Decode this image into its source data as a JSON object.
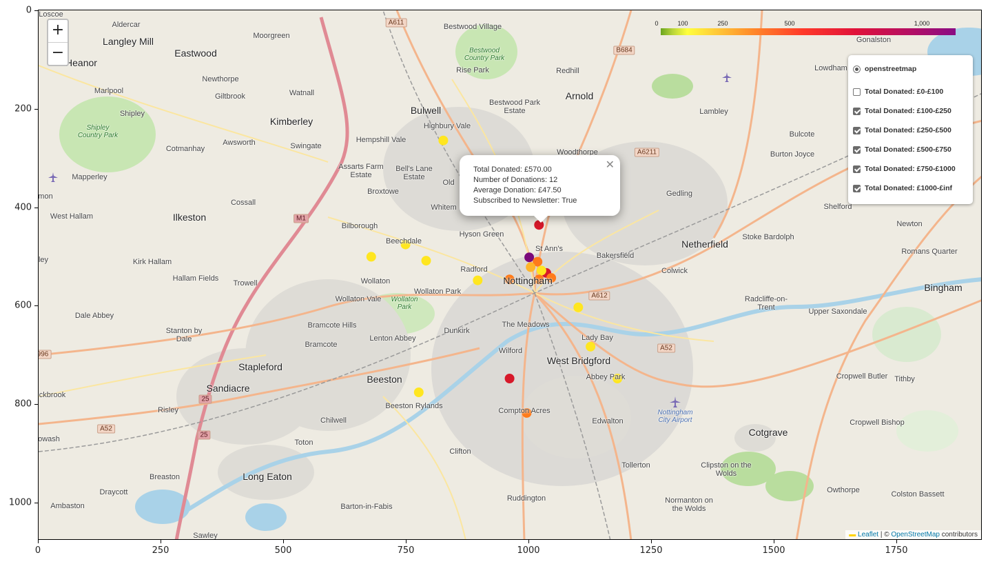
{
  "axes": {
    "x_ticks": [
      "0",
      "250",
      "500",
      "750",
      "1000",
      "1250",
      "1500",
      "1750"
    ],
    "y_ticks": [
      "0",
      "200",
      "400",
      "600",
      "800",
      "1000"
    ]
  },
  "zoom": {
    "in_label": "+",
    "out_label": "−"
  },
  "colorbar": {
    "labels": [
      "0",
      "100",
      "250",
      "500",
      "1,000"
    ],
    "colors": [
      "#6aa51f",
      "#ffff3c",
      "#ff8a2a",
      "#ff3a2a",
      "#e0123a",
      "#8a0c84"
    ]
  },
  "popup": {
    "close_label": "✕",
    "line1": "Total Donated: £570.00",
    "line2": "Number of Donations: 12",
    "line3": "Average Donation: £47.50",
    "line4": "Subscribed to Newsletter: True"
  },
  "layer_control": {
    "base_layer": "openstreetmap",
    "overlays": [
      {
        "label": "Total Donated: £0-£100",
        "checked": false
      },
      {
        "label": "Total Donated: £100-£250",
        "checked": true
      },
      {
        "label": "Total Donated: £250-£500",
        "checked": true
      },
      {
        "label": "Total Donated: £500-£750",
        "checked": true
      },
      {
        "label": "Total Donated: £750-£1000",
        "checked": true
      },
      {
        "label": "Total Donated: £1000-£inf",
        "checked": true
      }
    ]
  },
  "attribution": {
    "leaflet": "Leaflet",
    "sep": " | © ",
    "osm": "OpenStreetMap",
    "tail": " contributors",
    "flag": "▬"
  },
  "places": [
    "Loscoe",
    "Aldercar",
    "Langley Mill",
    "Eastwood",
    "Moorgreen",
    "Bestwood Village",
    "Heanor",
    "Newthorpe",
    "Giltbrook",
    "Watnall",
    "Marlpool",
    "Shipley",
    "Kimberley",
    "Bulwell",
    "Bestwood Park Estate",
    "Arnold",
    "Redhill",
    "Rise Park",
    "Hempshill Vale",
    "Highbury Vale",
    "Swingate",
    "Awsworth",
    "Cotmanhay",
    "Woodthorpe",
    "Assarts Farm Estate",
    "Bell's Lane Estate",
    "Broxtowe",
    "Mapperley",
    "Cossall",
    "Ilkeston",
    "West Hallam",
    "Gedling",
    "Lambley",
    "Burton Joyce",
    "Bulcote",
    "Shelford",
    "Newton",
    "Stoke Bardolph",
    "Netherfield",
    "Colwick",
    "Bakersfield",
    "St Ann's",
    "Hyson Green",
    "Bilborough",
    "Beechdale",
    "Kirk Hallam",
    "Hallam Fields",
    "Trowell",
    "Wollaton",
    "Wollaton Park",
    "Wollaton Vale",
    "Radford",
    "Nottingham",
    "Dale Abbey",
    "Bramcote Hills",
    "Bramcote",
    "Lenton Abbey",
    "Dunkirk",
    "The Meadows",
    "Lady Bay",
    "Wilford",
    "West Bridgford",
    "Abbey Park",
    "Stanton by Dale",
    "Stapleford",
    "Sandiacre",
    "Beeston",
    "Beeston Rylands",
    "Risley",
    "Chilwell",
    "Compton Acres",
    "Edwalton",
    "Toton",
    "Clifton",
    "Tollerton",
    "Long Eaton",
    "Breaston",
    "Draycott",
    "Ambaston",
    "Barton-in-Fabis",
    "Ruddington",
    "Sawley",
    "Normanton on the Wolds",
    "Clipston on the Wolds",
    "Cotgrave",
    "Owthorpe",
    "Colston Bassett",
    "Cropwell Bishop",
    "Cropwell Butler",
    "Tithby",
    "Radcliffe-on-Trent",
    "Upper Saxondale",
    "Bingham",
    "Romans Quarter",
    "Gonalston",
    "Lowdham",
    "Old",
    "Whitem",
    "mon",
    "ley",
    "ckbrook",
    "owash",
    "Shipley Country Park",
    "Bestwood Country Park",
    "Wollaton Park",
    "Nottingham City Airport"
  ],
  "road_labels": [
    "A611",
    "B684",
    "A6211",
    "M1",
    "A612",
    "A52",
    "A52",
    "996",
    "25",
    "25"
  ],
  "markers": [
    {
      "x": 825,
      "y": 265,
      "color": "#ffe620",
      "category": "£100-£250"
    },
    {
      "x": 1020,
      "y": 437,
      "color": "#d7192a",
      "category": "£500-£750"
    },
    {
      "x": 748,
      "y": 477,
      "color": "#ffe620",
      "category": "£100-£250"
    },
    {
      "x": 678,
      "y": 502,
      "color": "#ffe620",
      "category": "£100-£250"
    },
    {
      "x": 790,
      "y": 510,
      "color": "#ffe620",
      "category": "£100-£250"
    },
    {
      "x": 1000,
      "y": 503,
      "color": "#7a0a7a",
      "category": "£1000-£inf"
    },
    {
      "x": 1017,
      "y": 512,
      "color": "#ff7b1a",
      "category": "£250-£500"
    },
    {
      "x": 1003,
      "y": 523,
      "color": "#ffb52a",
      "category": "£250-£500"
    },
    {
      "x": 1035,
      "y": 535,
      "color": "#d7192a",
      "category": "£500-£750"
    },
    {
      "x": 1025,
      "y": 530,
      "color": "#ffe620",
      "category": "£100-£250"
    },
    {
      "x": 1020,
      "y": 548,
      "color": "#ff7b1a",
      "category": "£250-£500"
    },
    {
      "x": 1045,
      "y": 545,
      "color": "#ff7b1a",
      "category": "£250-£500"
    },
    {
      "x": 960,
      "y": 548,
      "color": "#ff7b1a",
      "category": "£250-£500"
    },
    {
      "x": 895,
      "y": 550,
      "color": "#ffe620",
      "category": "£100-£250"
    },
    {
      "x": 1100,
      "y": 605,
      "color": "#ffe620",
      "category": "£100-£250"
    },
    {
      "x": 1125,
      "y": 685,
      "color": "#ffe620",
      "category": "£100-£250"
    },
    {
      "x": 1180,
      "y": 750,
      "color": "#ffe620",
      "category": "£100-£250"
    },
    {
      "x": 960,
      "y": 750,
      "color": "#d7192a",
      "category": "£500-£750"
    },
    {
      "x": 775,
      "y": 778,
      "color": "#ffe620",
      "category": "£100-£250"
    },
    {
      "x": 995,
      "y": 820,
      "color": "#ff7b1a",
      "category": "£250-£500"
    }
  ]
}
